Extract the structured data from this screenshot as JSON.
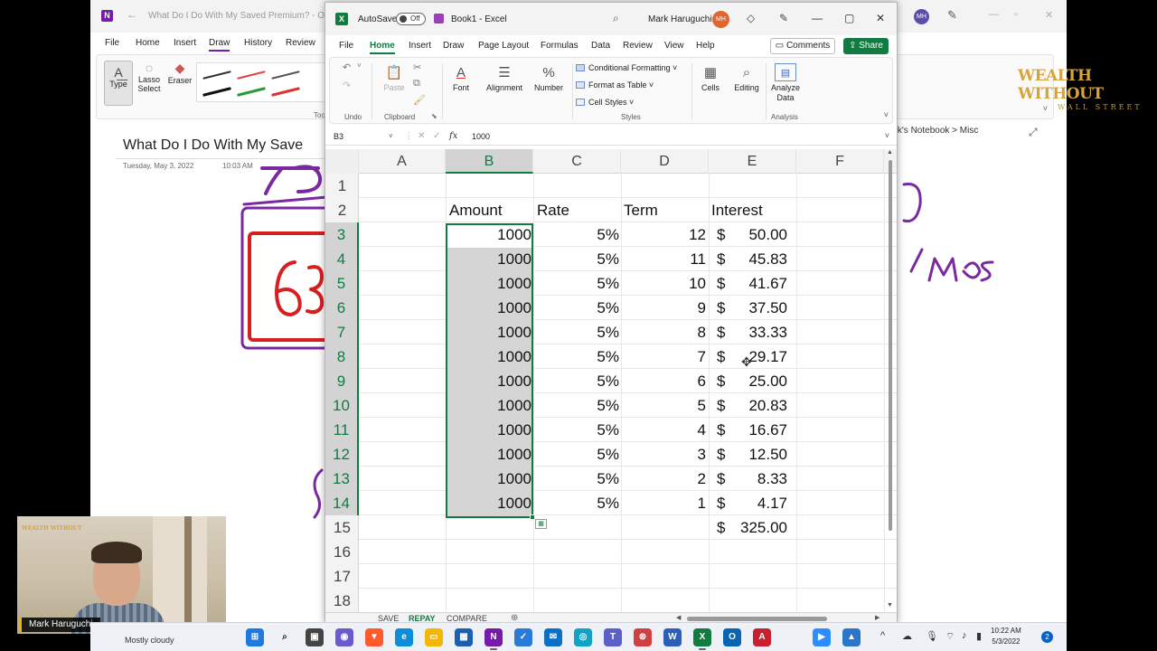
{
  "onenote": {
    "doc_title": "What Do I Do With My Saved Premium? - One",
    "back_glyph": "←",
    "avatar": "MH",
    "menu": [
      "File",
      "Home",
      "Insert",
      "Draw",
      "History",
      "Review"
    ],
    "ribbon": {
      "type": "Type",
      "lasso": "Lasso Select",
      "eraser": "Eraser",
      "tools_label": "Too"
    },
    "page_title": "What Do I Do With My Save",
    "page_date": "Tuesday, May 3, 2022",
    "page_time": "10:03 AM",
    "breadcrumb": "ark's Notebook > Misc",
    "ink_color": "#d62020",
    "ink_accent": "#7a2aa0"
  },
  "logo": {
    "line1": "WEALTH WITHOUT",
    "line2": "WALL STREET"
  },
  "excel": {
    "autosave_label": "AutoSave",
    "autosave_state": "Off",
    "book_title": "Book1  -  Excel",
    "user_name": "Mark Haruguchi",
    "user_initials": "MH",
    "menu": [
      "File",
      "Home",
      "Insert",
      "Draw",
      "Page Layout",
      "Formulas",
      "Data",
      "Review",
      "View",
      "Help"
    ],
    "comments_label": "Comments",
    "share_label": "Share",
    "ribbon": {
      "undo_label": "Undo",
      "paste_label": "Paste",
      "clipboard_label": "Clipboard",
      "font_label": "Font",
      "alignment_label": "Alignment",
      "number_label": "Number",
      "conditional_formatting": "Conditional Formatting ˅",
      "format_as_table": "Format as Table ˅",
      "cell_styles": "Cell Styles ˅",
      "styles_label": "Styles",
      "cells_label": "Cells",
      "editing_label": "Editing",
      "analyze_data_label": "Analyze Data",
      "analysis_label": "Analysis"
    },
    "name_box": "B3",
    "formula_content": "1000",
    "columns": [
      "A",
      "B",
      "C",
      "D",
      "E",
      "F"
    ],
    "rows": [
      "1",
      "2",
      "3",
      "4",
      "5",
      "6",
      "7",
      "8",
      "9",
      "10",
      "11",
      "12",
      "13",
      "14",
      "15",
      "16",
      "17",
      "18"
    ],
    "headers": {
      "amount": "Amount",
      "rate": "Rate",
      "term": "Term",
      "interest": "Interest"
    },
    "table": [
      {
        "amount": "1000",
        "rate": "5%",
        "term": "12",
        "interest": "50.00"
      },
      {
        "amount": "1000",
        "rate": "5%",
        "term": "11",
        "interest": "45.83"
      },
      {
        "amount": "1000",
        "rate": "5%",
        "term": "10",
        "interest": "41.67"
      },
      {
        "amount": "1000",
        "rate": "5%",
        "term": "9",
        "interest": "37.50"
      },
      {
        "amount": "1000",
        "rate": "5%",
        "term": "8",
        "interest": "33.33"
      },
      {
        "amount": "1000",
        "rate": "5%",
        "term": "7",
        "interest": "29.17"
      },
      {
        "amount": "1000",
        "rate": "5%",
        "term": "6",
        "interest": "25.00"
      },
      {
        "amount": "1000",
        "rate": "5%",
        "term": "5",
        "interest": "20.83"
      },
      {
        "amount": "1000",
        "rate": "5%",
        "term": "4",
        "interest": "16.67"
      },
      {
        "amount": "1000",
        "rate": "5%",
        "term": "3",
        "interest": "12.50"
      },
      {
        "amount": "1000",
        "rate": "5%",
        "term": "2",
        "interest": "8.33"
      },
      {
        "amount": "1000",
        "rate": "5%",
        "term": "1",
        "interest": "4.17"
      }
    ],
    "currency_symbol": "$",
    "total_interest": "325.00",
    "sheet_tabs": [
      "SAVE",
      "REPAY",
      "COMPARE"
    ],
    "active_sheet": "REPAY",
    "accent_color": "#107c41"
  },
  "webcam": {
    "name": "Mark Haruguchi",
    "logo": "WEALTH WITHOUT"
  },
  "taskbar": {
    "weather": "Mostly cloudy",
    "time": "10:22 AM",
    "date": "5/3/2022",
    "notification_count": "2"
  }
}
